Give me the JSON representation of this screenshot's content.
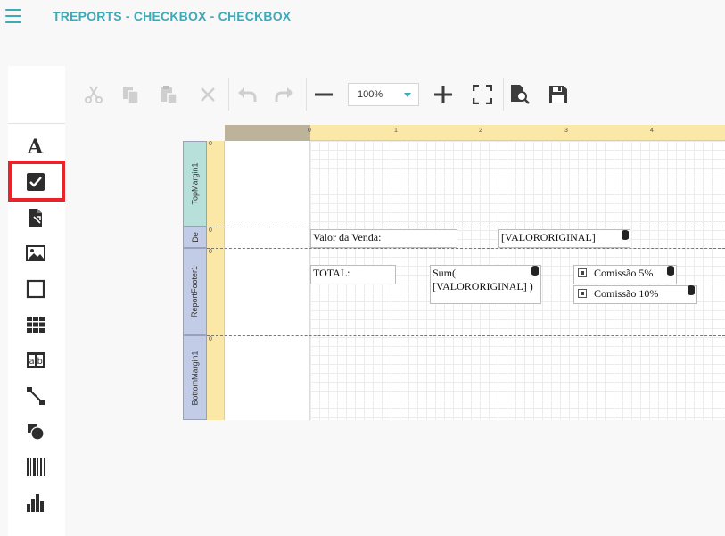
{
  "app": {
    "title": "TREPORTS - CHECKBOX - CHECKBOX"
  },
  "toolbox": {
    "items": [
      "text-label",
      "checkbox",
      "rich-text",
      "picture-box",
      "panel",
      "table",
      "character-comb",
      "line",
      "shape",
      "barcode",
      "chart"
    ],
    "selected": "checkbox"
  },
  "annotation": {
    "color": "#e8232a"
  },
  "toolbar": {
    "zoom": "100%"
  },
  "ruler": {
    "ticks": [
      "0",
      "1",
      "2",
      "3",
      "4"
    ]
  },
  "bands": {
    "top_margin": "TopMargin1",
    "detail": "De",
    "report_footer": "ReportFooter1",
    "bottom_margin": "BottomMargin1",
    "ruler_marks": [
      "0",
      "0",
      "0",
      "0"
    ]
  },
  "controls": {
    "valor_label": "Valor da Venda:",
    "valor_field": "[VALORORIGINAL]",
    "total_label": "TOTAL:",
    "sum_line1": "Sum(",
    "sum_line2": "[VALORORIGINAL] )",
    "comissao5": "Comissão 5%",
    "comissao10": "Comissão 10%"
  },
  "colors": {
    "accent": "#3fa9b6",
    "ruler": "#fbe7a6",
    "band_top": "#b7e0db",
    "band": "#c3cce6"
  }
}
